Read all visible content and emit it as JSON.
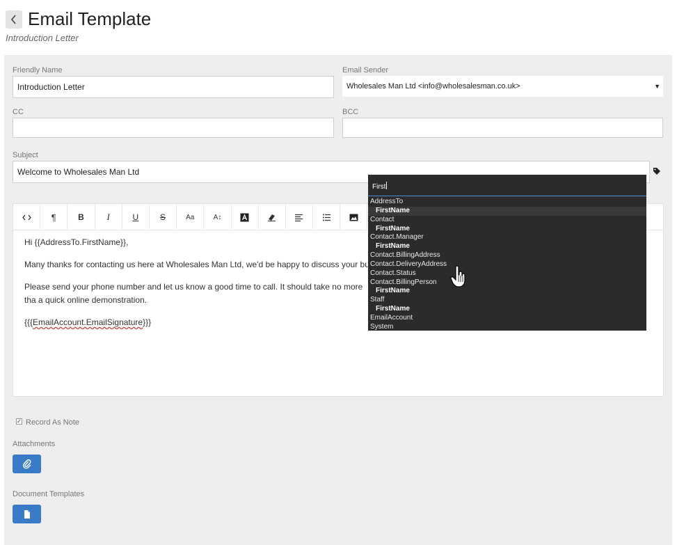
{
  "header": {
    "title": "Email Template",
    "subtitle": "Introduction Letter"
  },
  "form": {
    "friendly_name": {
      "label": "Friendly Name",
      "value": "Introduction Letter"
    },
    "email_sender": {
      "label": "Email Sender",
      "value": "Wholesales Man Ltd <info@wholesalesman.co.uk>"
    },
    "cc": {
      "label": "CC",
      "value": ""
    },
    "bcc": {
      "label": "BCC",
      "value": ""
    },
    "subject": {
      "label": "Subject",
      "value": "Welcome to Wholesales Man Ltd"
    }
  },
  "toolbar": {
    "buttons": [
      {
        "name": "code-view",
        "icon": "code-icon",
        "glyph": "<>"
      },
      {
        "name": "paragraph",
        "icon": "paragraph-icon",
        "glyph": "¶"
      },
      {
        "name": "bold",
        "icon": "bold-icon",
        "glyph": "B"
      },
      {
        "name": "italic",
        "icon": "italic-icon",
        "glyph": "I"
      },
      {
        "name": "underline",
        "icon": "underline-icon",
        "glyph": "U"
      },
      {
        "name": "strikethrough",
        "icon": "strikethrough-icon",
        "glyph": "S"
      },
      {
        "name": "font-size",
        "icon": "font-size-icon",
        "glyph": "Aa"
      },
      {
        "name": "line-height",
        "icon": "line-height-icon",
        "glyph": "A↕"
      },
      {
        "name": "text-color",
        "icon": "text-color-icon",
        "glyph": "A"
      },
      {
        "name": "clear-format",
        "icon": "eraser-icon",
        "glyph": ""
      },
      {
        "name": "align",
        "icon": "align-icon",
        "glyph": ""
      },
      {
        "name": "list",
        "icon": "list-icon",
        "glyph": ""
      },
      {
        "name": "image",
        "icon": "image-icon",
        "glyph": ""
      },
      {
        "name": "video",
        "icon": "video-icon",
        "glyph": ""
      },
      {
        "name": "table",
        "icon": "table-icon",
        "glyph": ""
      },
      {
        "name": "link",
        "icon": "link-icon",
        "glyph": ""
      },
      {
        "name": "horizontal-rule",
        "icon": "horizontal-rule-icon",
        "glyph": ""
      },
      {
        "name": "template",
        "icon": "template-icon",
        "glyph": ""
      },
      {
        "name": "tag",
        "icon": "tag-icon",
        "glyph": ""
      },
      {
        "name": "search",
        "icon": "search-icon",
        "glyph": ""
      },
      {
        "name": "fullscreen",
        "icon": "expand-icon",
        "glyph": ""
      }
    ]
  },
  "editor": {
    "greeting": "Hi {{AddressTo.FirstName}},",
    "line2": "Many thanks for contacting us here at Wholesales Man Ltd, we'd be happy to discuss your busin",
    "line3": "Please send your phone number and let us know a good time to call. It should take no more tha a quick online demonstration.",
    "signature_prefix": "{{{",
    "signature_token": "EmailAccount.EmailSignature",
    "signature_suffix": "}}}"
  },
  "autocomplete": {
    "query": "First",
    "items": [
      {
        "label": "AddressTo",
        "level": 0
      },
      {
        "label": "FirstName",
        "level": 1,
        "highlight": true
      },
      {
        "label": "Contact",
        "level": 0
      },
      {
        "label": "FirstName",
        "level": 1
      },
      {
        "label": "Contact.Manager",
        "level": 0
      },
      {
        "label": "FirstName",
        "level": 1
      },
      {
        "label": "Contact.BillingAddress",
        "level": 0
      },
      {
        "label": "Contact.DeliveryAddress",
        "level": 0
      },
      {
        "label": "Contact.Status",
        "level": 0
      },
      {
        "label": "Contact.BillingPerson",
        "level": 0
      },
      {
        "label": "FirstName",
        "level": 1
      },
      {
        "label": "Staff",
        "level": 0
      },
      {
        "label": "FirstName",
        "level": 1
      },
      {
        "label": "EmailAccount",
        "level": 0
      },
      {
        "label": "System",
        "level": 0
      }
    ]
  },
  "options": {
    "record_as_note": {
      "label": "Record As Note",
      "checked": true
    },
    "attachments_label": "Attachments",
    "document_templates_label": "Document Templates"
  },
  "colors": {
    "accent": "#3a7bc8",
    "panel_bg": "#eeeeee",
    "dropdown_bg": "#2b2b2b"
  }
}
